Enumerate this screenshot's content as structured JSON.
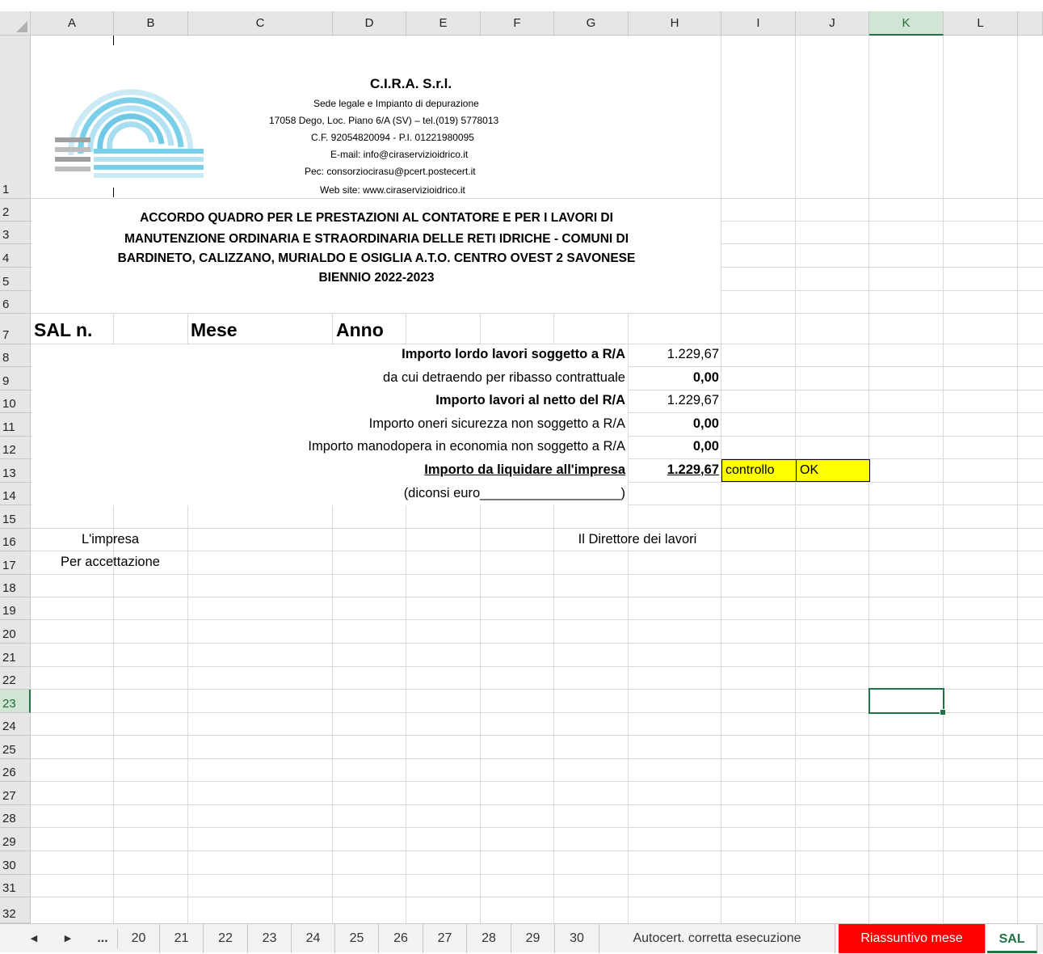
{
  "columns": [
    "A",
    "B",
    "C",
    "D",
    "E",
    "F",
    "G",
    "H",
    "I",
    "J",
    "K",
    "L"
  ],
  "rows": [
    "1",
    "2",
    "3",
    "4",
    "5",
    "6",
    "7",
    "8",
    "9",
    "10",
    "11",
    "12",
    "13",
    "14",
    "15",
    "16",
    "17",
    "18",
    "19",
    "20",
    "21",
    "22",
    "23",
    "24",
    "25",
    "26",
    "27",
    "28",
    "29",
    "30",
    "31",
    "32"
  ],
  "header": {
    "company": "C.I.R.A. S.r.l.",
    "line1": "Sede legale e Impianto di depurazione",
    "line2": "17058 Dego, Loc. Piano 6/A (SV) – tel.(019) 5778013",
    "line3": "C.F.  92054820094 - P.I. 01221980095",
    "line4": "E-mail: info@ciraservizioidrico.it",
    "line5": "Pec: consorziocirasu@pcert.postecert.it",
    "line6": "Web site: www.ciraservizioidrico.it",
    "logo_icon": "cira-logo-icon"
  },
  "title": {
    "line1": "ACCORDO QUADRO PER LE PRESTAZIONI AL CONTATORE E PER I LAVORI DI",
    "line2": "MANUTENZIONE ORDINARIA E STRAORDINARIA DELLE RETI IDRICHE - COMUNI DI",
    "line3": "BARDINETO, CALIZZANO, MURIALDO E OSIGLIA A.T.O. CENTRO OVEST 2 SAVONESE",
    "line4": "BIENNIO 2022-2023"
  },
  "sal": {
    "sal_label": "SAL n.",
    "mese_label": "Mese",
    "anno_label": "Anno"
  },
  "amounts": {
    "r8_label": "Importo lordo lavori soggetto a R/A",
    "r8_value": "1.229,67",
    "r9_label": "da cui detraendo per ribasso contrattuale",
    "r9_value": "0,00",
    "r10_label": "Importo lavori al netto del R/A",
    "r10_value": "1.229,67",
    "r11_label": "Importo oneri sicurezza non soggetto a R/A",
    "r11_value": "0,00",
    "r12_label": "Importo manodopera in economia non soggetto a R/A",
    "r12_value": "0,00",
    "r13_label": "Importo da liquidare all'impresa",
    "r13_value": "1.229,67",
    "r14_label": "(diconsi euro___________________)"
  },
  "check": {
    "label": "controllo",
    "value": "OK",
    "color": "#ffff00"
  },
  "signatures": {
    "impresa": "L'impresa",
    "accettazione": "Per accettazione",
    "direttore": "Il Direttore dei lavori"
  },
  "selected_cell": "K23",
  "tabs": {
    "nav_prev": "◀",
    "nav_next": "▶",
    "nav_more": "...",
    "items": [
      "20",
      "21",
      "22",
      "23",
      "24",
      "25",
      "26",
      "27",
      "28",
      "29",
      "30"
    ],
    "autocert": "Autocert. corretta esecuzione",
    "riassuntivo": "Riassuntivo mese",
    "sal": "SAL",
    "riassuntivo_color": "#ff0000",
    "accent": "#217346"
  }
}
